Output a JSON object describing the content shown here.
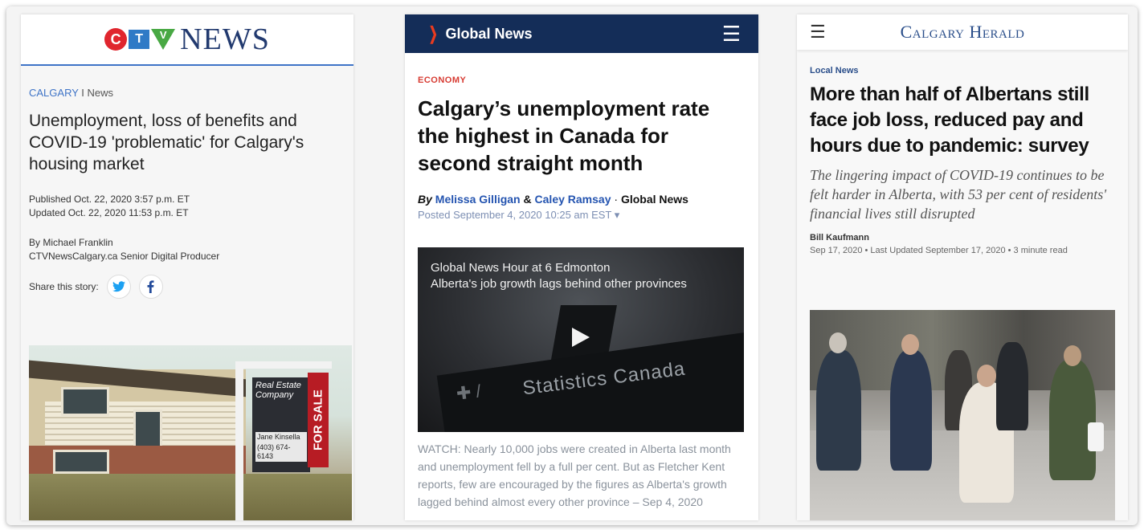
{
  "ctv": {
    "logo": {
      "c": "C",
      "t": "T",
      "v": "V",
      "news": "NEWS"
    },
    "section_city": "CALGARY",
    "section_sep": " I ",
    "section_name": "News",
    "title": "Unemployment, loss of benefits and COVID-19 'problematic' for Calgary's housing market",
    "published": "Published Oct. 22, 2020 3:57 p.m. ET",
    "updated": "Updated Oct. 22, 2020 11:53 p.m. ET",
    "author": "By Michael Franklin",
    "author_role": "CTVNewsCalgary.ca Senior Digital Producer",
    "share_label": "Share this story:",
    "share_twitter_icon": "twitter-icon",
    "share_facebook_icon": "facebook-icon",
    "sign_company": "Real Estate Company",
    "sign_agent": "Jane Kinsella",
    "sign_phone": "(403) 674-6143",
    "sign_sale": "FOR SALE"
  },
  "global": {
    "logo": "Global News",
    "category": "ECONOMY",
    "title": "Calgary’s unemployment rate the highest in Canada for second straight month",
    "by_prefix": "By",
    "author1": "Melissa Gilligan",
    "amp": "&",
    "author2": "Caley Ramsay",
    "dot": "·",
    "source": "Global News",
    "posted": "Posted September 4, 2020 10:25 am EST ▾",
    "video_line1": "Global News Hour at 6 Edmonton",
    "video_line2": "Alberta's job growth lags behind other provinces",
    "video_building_text": "Statistics Canada",
    "caption": "WATCH: Nearly 10,000 jobs were created in Alberta last month and unemployment fell by a full per cent. But as Fletcher Kent reports, few are encouraged by the figures as Alberta's growth lagged behind almost every other province – Sep 4, 2020"
  },
  "herald": {
    "logo": "Calgary Herald",
    "category": "Local News",
    "title": "More than half of Albertans still face job loss, reduced pay and hours due to pandemic: survey",
    "deck": "The lingering impact of COVID-19 continues to be felt harder in Alberta, with 53 per cent of residents' financial lives still disrupted",
    "author": "Bill Kaufmann",
    "date": "Sep 17, 2020 • Last Updated September 17, 2020 • 3 minute read"
  }
}
